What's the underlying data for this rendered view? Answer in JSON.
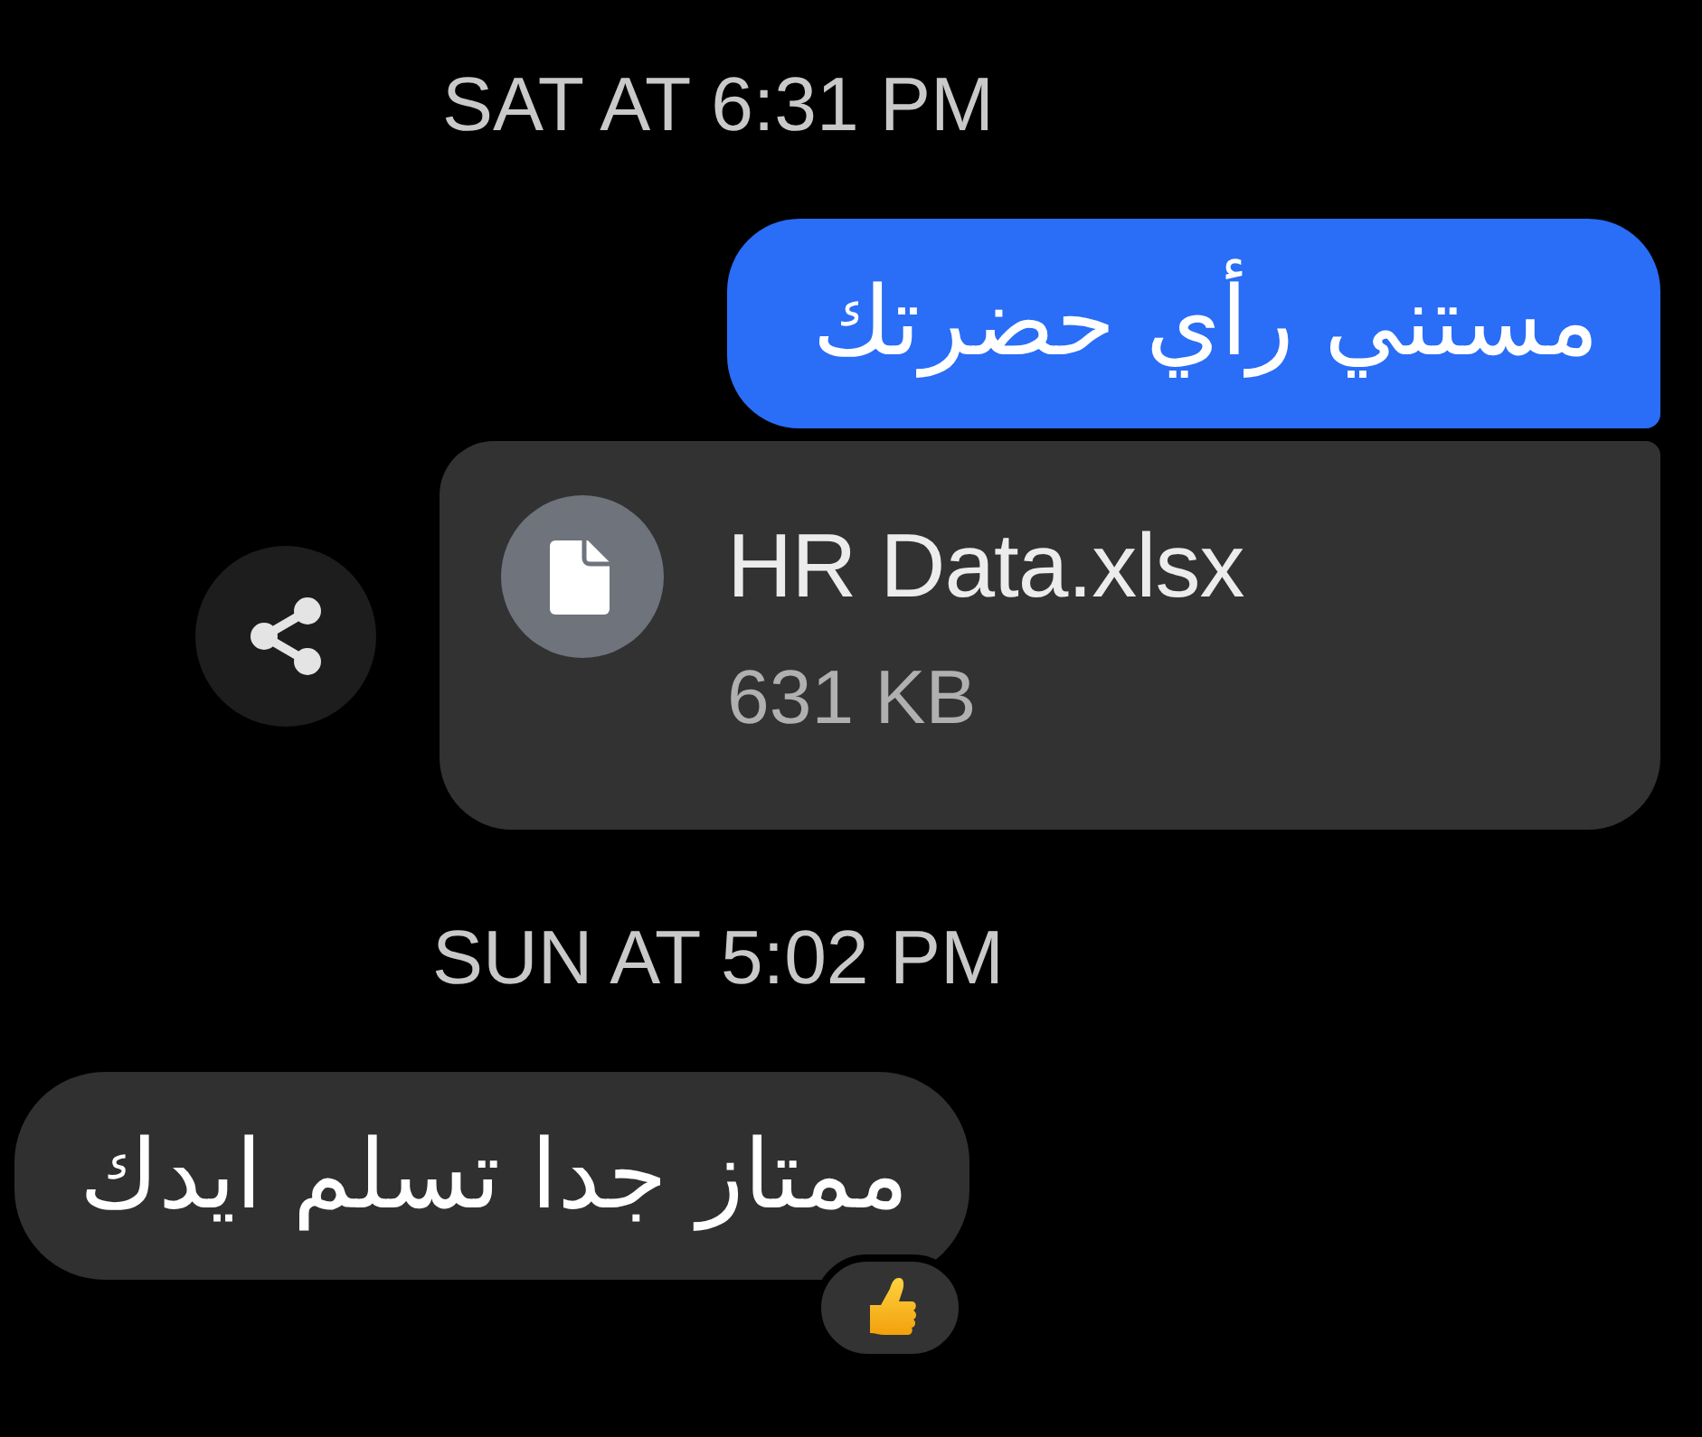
{
  "messages": [
    {
      "kind": "timestamp",
      "text": "SAT AT 6:31 PM"
    },
    {
      "kind": "sent_text",
      "text": "مستني رأي حضرتك"
    },
    {
      "kind": "sent_file",
      "file_name": "HR Data.xlsx",
      "file_size": "631 KB"
    },
    {
      "kind": "timestamp",
      "text": "SUN AT 5:02 PM"
    },
    {
      "kind": "received_text",
      "text": "ممتاز جدا تسلم ايدك",
      "reactions": [
        {
          "kind": "thumbs_up"
        }
      ]
    }
  ]
}
